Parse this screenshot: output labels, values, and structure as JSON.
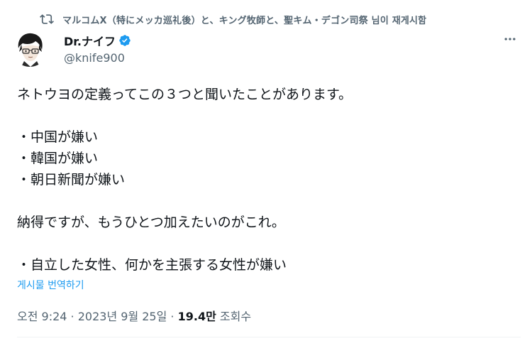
{
  "retweet": {
    "icon": "retweet-icon",
    "text": "マルコムX（特にメッカ巡礼後）と、キング牧師と、聖キム・デゴン司祭 님이 재게시함"
  },
  "author": {
    "display_name": "Dr.ナイフ",
    "handle": "@knife900",
    "verified_icon": "verified-badge-icon",
    "verified_color": "#1d9bf0"
  },
  "tweet": {
    "lines": [
      "ネトウヨの定義ってこの３つと聞いたことがあります。",
      "",
      "・中国が嫌い",
      "・韓国が嫌い",
      "・朝日新聞が嫌い",
      "",
      "納得ですが、もうひとつ加えたいのがこれ。",
      "",
      "・自立した女性、何かを主張する女性が嫌い"
    ],
    "translate_label": "게시물 번역하기"
  },
  "meta": {
    "time": "오전 9:24",
    "separator": " · ",
    "date": "2023년 9월 25일",
    "views_count": "19.4만",
    "views_label": " 조회수"
  },
  "colors": {
    "text": "#0f1419",
    "secondary": "#536471",
    "link": "#1d9bf0"
  }
}
